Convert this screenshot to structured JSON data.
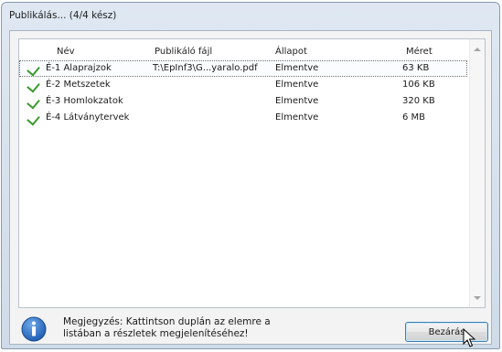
{
  "window": {
    "title": "Publikálás... (4/4 kész)"
  },
  "list": {
    "columns": [
      "Név",
      "Publikáló fájl",
      "Állapot",
      "Méret"
    ],
    "rows": [
      {
        "status_icon": "check-icon",
        "name": "É-1 Alaprajzok",
        "file": "T:\\EpInf3\\G...yaralo.pdf",
        "state": "Elmentve",
        "size": "63 KB"
      },
      {
        "status_icon": "check-icon",
        "name": "É-2 Metszetek",
        "file": "",
        "state": "Elmentve",
        "size": "106 KB"
      },
      {
        "status_icon": "check-icon",
        "name": "É-3 Homlokzatok",
        "file": "",
        "state": "Elmentve",
        "size": "320 KB"
      },
      {
        "status_icon": "check-icon",
        "name": "É-4 Látványtervek",
        "file": "",
        "state": "Elmentve",
        "size": "6 MB"
      }
    ]
  },
  "note": {
    "icon": "info-icon",
    "text": "Megjegyzés: Kattintson duplán az elemre a listában a részletek megjelenítéséhez!"
  },
  "buttons": {
    "close_label": "Bezárás"
  },
  "colors": {
    "check": "#3a9a2e",
    "info_icon": "#1f5fb4"
  }
}
